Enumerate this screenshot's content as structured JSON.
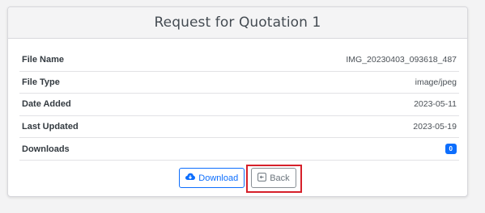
{
  "header": {
    "title": "Request for Quotation 1"
  },
  "details": [
    {
      "label": "File Name",
      "value": "IMG_20230403_093618_487"
    },
    {
      "label": "File Type",
      "value": "image/jpeg"
    },
    {
      "label": "Date Added",
      "value": "2023-05-11"
    },
    {
      "label": "Last Updated",
      "value": "2023-05-19"
    },
    {
      "label": "Downloads",
      "value": "0"
    }
  ],
  "actions": {
    "download_label": "Download",
    "back_label": "Back",
    "download_icon": "cloud-download-icon",
    "back_icon": "arrow-left-square-icon"
  },
  "colors": {
    "primary": "#0d6efd",
    "secondary": "#6c757d",
    "highlight": "#d6202a"
  }
}
